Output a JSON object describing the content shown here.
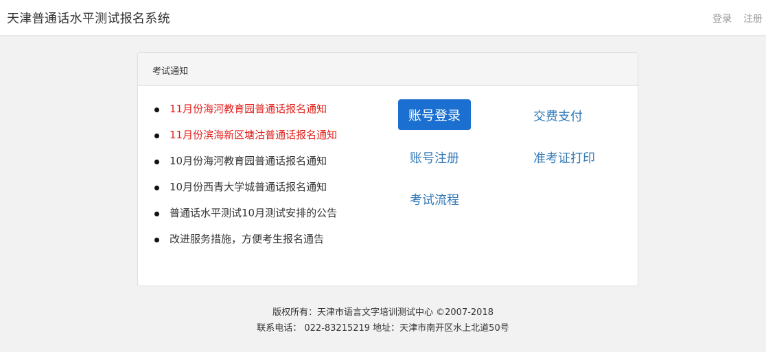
{
  "header": {
    "title": "天津普通话水平测试报名系统",
    "login": "登录",
    "register": "注册"
  },
  "panel": {
    "title": "考试通知",
    "notices": [
      {
        "text": "11月份海河教育园普通话报名通知",
        "color": "#e2211c"
      },
      {
        "text": "11月份滨海新区塘沽普通话报名通知",
        "color": "#e2211c"
      },
      {
        "text": "10月份海河教育园普通话报名通知",
        "color": "#333333"
      },
      {
        "text": "10月份西青大学城普通话报名通知",
        "color": "#333333"
      },
      {
        "text": "普通话水平测试10月测试安排的公告",
        "color": "#333333"
      },
      {
        "text": "改进服务措施，方便考生报名通告",
        "color": "#333333"
      }
    ],
    "actions": {
      "account_login": "账号登录",
      "payment": "交费支付",
      "account_register": "账号注册",
      "admit_card_print": "准考证打印",
      "exam_process": "考试流程"
    }
  },
  "footer": {
    "copyright": "版权所有：天津市语言文字培训测试中心 ©2007-2018",
    "contact": "联系电话： 022-83215219 地址：天津市南开区水上北道50号"
  },
  "colors": {
    "primary_button": "#1a6fd0",
    "link": "#337ab7",
    "highlight_notice": "#e2211c"
  }
}
